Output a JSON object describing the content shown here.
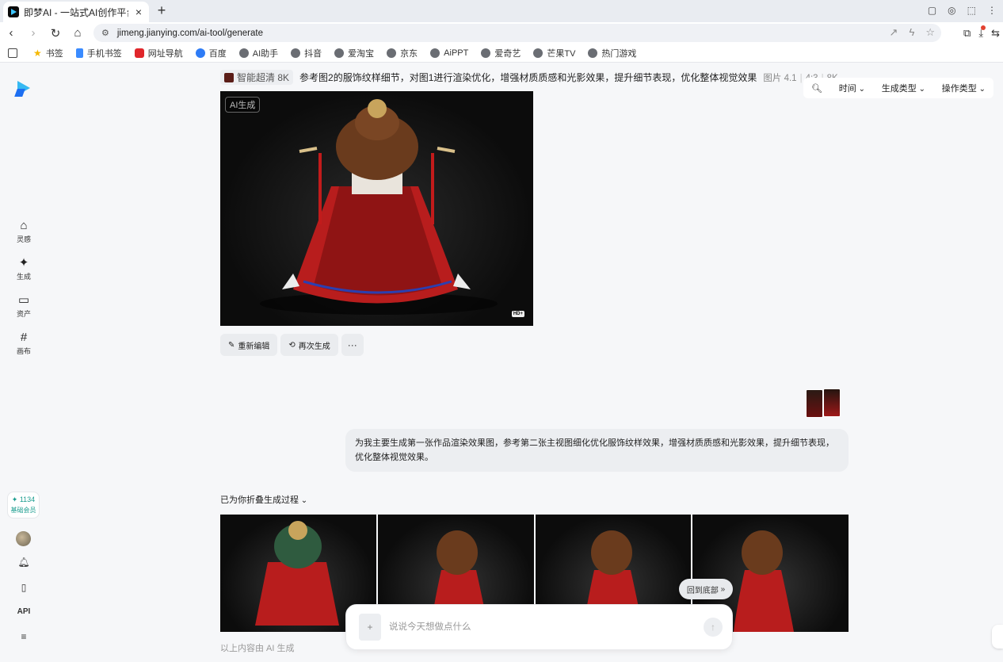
{
  "browser": {
    "tab_title": "即梦AI - 一站式AI创作平台",
    "url": "jimeng.jianying.com/ai-tool/generate",
    "bookmarks": [
      "书签",
      "手机书签",
      "网址导航",
      "百度",
      "AI助手",
      "抖音",
      "爱淘宝",
      "京东",
      "AiPPT",
      "爱奇艺",
      "芒果TV",
      "热门游戏"
    ]
  },
  "sidebar": {
    "items": [
      {
        "label": "灵感",
        "icon": "home-icon"
      },
      {
        "label": "生成",
        "icon": "sparkle-icon"
      },
      {
        "label": "资产",
        "icon": "folder-icon"
      },
      {
        "label": "画布",
        "icon": "canvas-icon"
      }
    ],
    "member_points": "✦ 1134",
    "member_level": "基础会员",
    "api_label": "API"
  },
  "filters": {
    "time": "时间",
    "gen_type": "生成类型",
    "op_type": "操作类型"
  },
  "record": {
    "tag": "智能超清 8K",
    "prompt": "参考图2的服饰纹样细节，对图1进行渲染优化，增强材质质感和光影效果，提升细节表现，优化整体视觉效果",
    "model": "图片 4.1",
    "ratio": "4:3",
    "resolution": "8K",
    "ai_badge": "AI生成",
    "hd_badge": "HD+",
    "actions": {
      "reedit": "重新编辑",
      "regenerate": "再次生成",
      "more": "···"
    }
  },
  "chat": {
    "user_message": "为我主要生成第一张作品渲染效果图，参考第二张主视图细化优化服饰纹样效果，增强材质质感和光影效果，提升细节表现，优化整体视觉效果。",
    "collapsed_label": "已为你折叠生成过程",
    "back_to_bottom": "回到底部",
    "footer_note": "以上内容由 AI 生成"
  },
  "input": {
    "placeholder": "说说今天想做点什么",
    "attach": "+"
  },
  "colors": {
    "accent": "#1a9c8e",
    "brand": "#36b9f2",
    "figure_red": "#b81d1d"
  }
}
